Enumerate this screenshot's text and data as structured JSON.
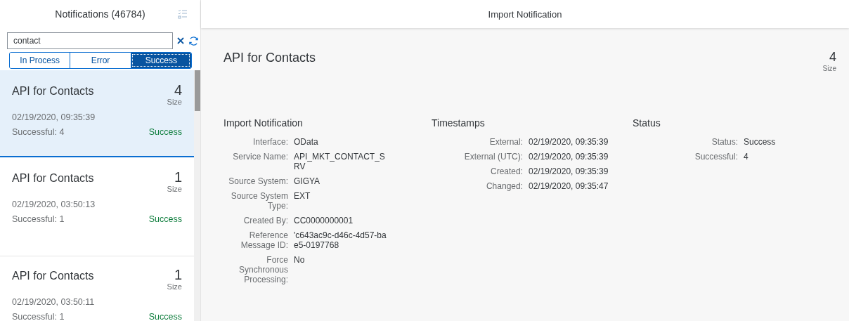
{
  "list_header": {
    "title": "Notifications (46784)"
  },
  "search": {
    "value": "contact"
  },
  "filters": [
    {
      "label": "In Process",
      "selected": false
    },
    {
      "label": "Error",
      "selected": false
    },
    {
      "label": "Success",
      "selected": true
    }
  ],
  "notifications": [
    {
      "title": "API for Contacts",
      "size": "4",
      "size_label": "Size",
      "time": "02/19/2020, 09:35:39",
      "count": "Successful: 4",
      "status": "Success",
      "selected": true
    },
    {
      "title": "API for Contacts",
      "size": "1",
      "size_label": "Size",
      "time": "02/19/2020, 03:50:13",
      "count": "Successful: 1",
      "status": "Success",
      "selected": false
    },
    {
      "title": "API for Contacts",
      "size": "1",
      "size_label": "Size",
      "time": "02/19/2020, 03:50:11",
      "count": "Successful: 1",
      "status": "Success",
      "selected": false
    }
  ],
  "detail": {
    "header": "Import Notification",
    "title": "API for Contacts",
    "size": "4",
    "size_label": "Size",
    "sections": [
      {
        "title": "Import Notification",
        "fields": [
          {
            "label": "Interface:",
            "value": "OData"
          },
          {
            "label": "Service Name:",
            "value": "API_MKT_CONTACT_SRV"
          },
          {
            "label": "Source System:",
            "value": "GIGYA"
          },
          {
            "label": "Source System Type:",
            "value": "EXT"
          },
          {
            "label": "Created By:",
            "value": "CC0000000001"
          },
          {
            "label": "Reference Message ID:",
            "value": "'c643ac9c-d46c-4d57-bae5-0197768"
          },
          {
            "label": "Force Synchronous Processing:",
            "value": "No"
          }
        ]
      },
      {
        "title": "Timestamps",
        "fields": [
          {
            "label": "External:",
            "value": "02/19/2020, 09:35:39"
          },
          {
            "label": "External (UTC):",
            "value": "02/19/2020, 09:35:39"
          },
          {
            "label": "Created:",
            "value": "02/19/2020, 09:35:39"
          },
          {
            "label": "Changed:",
            "value": "02/19/2020, 09:35:47"
          }
        ]
      },
      {
        "title": "Status",
        "fields": [
          {
            "label": "Status:",
            "value": "Success"
          },
          {
            "label": "Successful:",
            "value": "4"
          }
        ]
      }
    ]
  }
}
